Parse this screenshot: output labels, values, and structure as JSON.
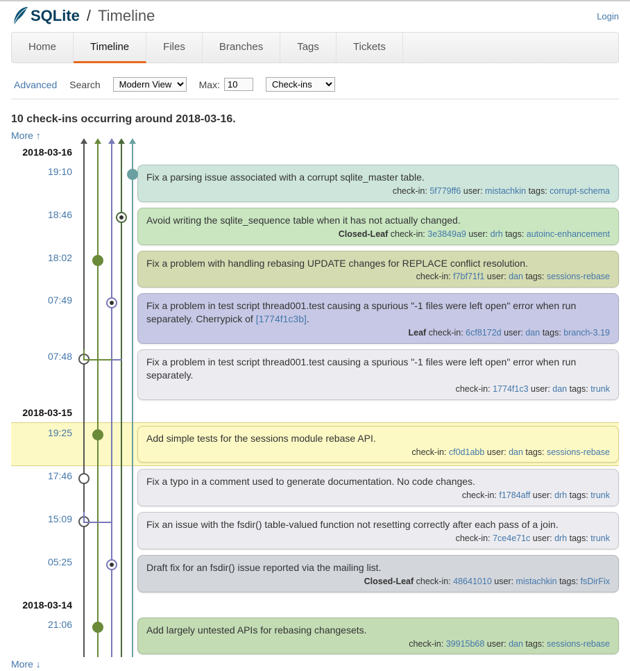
{
  "header": {
    "brand": "SQLite",
    "slash": "/",
    "page": "Timeline",
    "login": "Login"
  },
  "nav": {
    "items": [
      "Home",
      "Timeline",
      "Files",
      "Branches",
      "Tags",
      "Tickets"
    ],
    "active_index": 1
  },
  "controls": {
    "advanced": "Advanced",
    "search": "Search",
    "view_value": "Modern View",
    "max_label": "Max:",
    "max_value": "10",
    "type_value": "Check-ins"
  },
  "summary": "10 check-ins occurring around 2018-03-16.",
  "more_up": "More ↑",
  "more_down": "More ↓",
  "labels": {
    "checkin": "check-in:",
    "user": "user:",
    "tags": "tags:",
    "closed_leaf": "Closed-Leaf",
    "leaf": "Leaf"
  },
  "rows": [
    {
      "kind": "date",
      "text": "2018-03-16"
    },
    {
      "kind": "event",
      "time": "19:10",
      "theme": "c-teal",
      "desc": "Fix a parsing issue associated with a corrupt sqlite_master table.",
      "hash": "5f779ff6",
      "user": "mistachkin",
      "tags": "corrupt-schema"
    },
    {
      "kind": "event",
      "time": "18:46",
      "theme": "c-green",
      "desc": "Avoid writing the sqlite_sequence table when it has not actually changed.",
      "leaf": "closed",
      "hash": "3e3849a9",
      "user": "drh",
      "tags": "autoinc-enhancement"
    },
    {
      "kind": "event",
      "time": "18:02",
      "theme": "c-olive",
      "desc": "Fix a problem with handling rebasing UPDATE changes for REPLACE conflict resolution.",
      "hash": "f7bf71f1",
      "user": "dan",
      "tags": "sessions-rebase"
    },
    {
      "kind": "event",
      "time": "07:49",
      "theme": "c-purple",
      "desc": "Fix a problem in test script thread001.test causing a spurious \"-1 files were left open\" error when run separately. Cherrypick of ",
      "inline_link": "[1774f1c3b]",
      "desc_after": ".",
      "leaf": "leaf",
      "hash": "6cf8172d",
      "user": "dan",
      "tags": "branch-3.19"
    },
    {
      "kind": "event",
      "time": "07:48",
      "theme": "c-gray",
      "desc": "Fix a problem in test script thread001.test causing a spurious \"-1 files were left open\" error when run separately.",
      "hash": "1774f1c3",
      "user": "dan",
      "tags": "trunk"
    },
    {
      "kind": "date",
      "text": "2018-03-15"
    },
    {
      "kind": "event",
      "time": "19:25",
      "theme": "c-yellow",
      "highlight": true,
      "desc": "Add simple tests for the sessions module rebase API.",
      "hash": "cf0d1abb",
      "user": "dan",
      "tags": "sessions-rebase"
    },
    {
      "kind": "event",
      "time": "17:46",
      "theme": "c-gray",
      "desc": "Fix a typo in a comment used to generate documentation. No code changes.",
      "hash": "f1784aff",
      "user": "drh",
      "tags": "trunk"
    },
    {
      "kind": "event",
      "time": "15:09",
      "theme": "c-gray",
      "desc": "Fix an issue with the fsdir() table-valued function not resetting correctly after each pass of a join.",
      "hash": "7ce4e71c",
      "user": "drh",
      "tags": "trunk"
    },
    {
      "kind": "event",
      "time": "05:25",
      "theme": "c-slate",
      "desc": "Draft fix for an fsdir() issue reported via the mailing list.",
      "leaf": "closed",
      "hash": "48641010",
      "user": "mistachkin",
      "tags": "fsDirFix"
    },
    {
      "kind": "date",
      "text": "2018-03-14"
    },
    {
      "kind": "event",
      "time": "21:06",
      "theme": "c-green2",
      "desc": "Add largely untested APIs for rebasing changesets.",
      "hash": "39915b68",
      "user": "dan",
      "tags": "sessions-rebase"
    }
  ],
  "graph": {
    "rails": [
      {
        "x": 14,
        "color": "#555555"
      },
      {
        "x": 34,
        "color": "#6a8a3a"
      },
      {
        "x": 54,
        "color": "#7a78b8"
      },
      {
        "x": 68,
        "color": "#4a6a3a"
      },
      {
        "x": 84,
        "color": "#6aa0a0"
      }
    ]
  }
}
